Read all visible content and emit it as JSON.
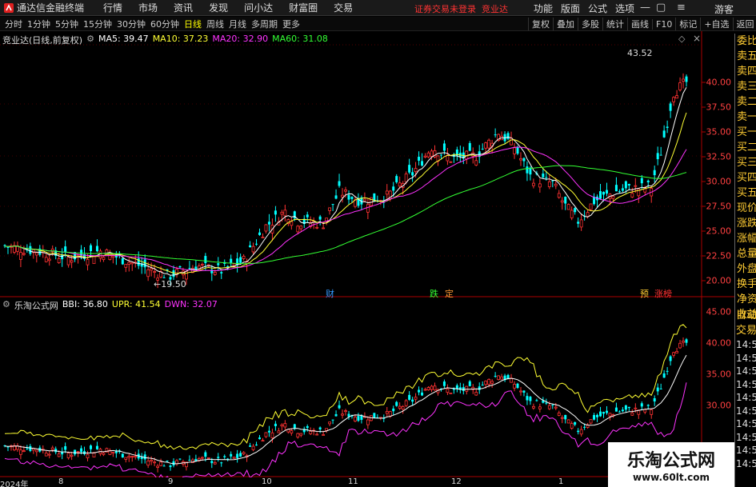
{
  "app": {
    "name": "通达信金融终端",
    "menu": [
      "行情",
      "市场",
      "资讯",
      "发现",
      "问小达",
      "财富圈",
      "交易"
    ],
    "notice": "证券交易未登录",
    "stock_short": "竞业达",
    "right_menu": [
      "功能",
      "版面",
      "公式",
      "选项"
    ],
    "guest": "游客"
  },
  "toolbar": {
    "periods": [
      "分时",
      "1分钟",
      "5分钟",
      "15分钟",
      "30分钟",
      "60分钟",
      "日线",
      "周线",
      "月线",
      "多周期",
      "更多"
    ],
    "active": "日线",
    "tools": [
      "复权",
      "叠加",
      "多股",
      "统计",
      "画线",
      "F10",
      "标记",
      "+自选",
      "返回"
    ]
  },
  "main_pane": {
    "title": "竞业达(日线,前复权)",
    "ma": [
      {
        "label": "MA5: 39.47",
        "color": "#ffffff"
      },
      {
        "label": "MA10: 37.23",
        "color": "#ffff33"
      },
      {
        "label": "MA20: 32.90",
        "color": "#ff33ff"
      },
      {
        "label": "MA60: 31.08",
        "color": "#33ff33"
      }
    ],
    "yticks": [
      "40.00",
      "37.50",
      "35.00",
      "32.50",
      "30.00",
      "27.50",
      "25.00",
      "22.50",
      "20.00"
    ],
    "annot_high": "43.52",
    "annot_low": "19.50",
    "events": [
      {
        "label": "财",
        "color": "#3399ff"
      },
      {
        "label": "跌",
        "color": "#33ff33"
      },
      {
        "label": "定",
        "color": "#ff9933"
      },
      {
        "label": "预",
        "color": "#ffcc33"
      },
      {
        "label": "涨榜",
        "color": "#ff3333"
      }
    ]
  },
  "sub_pane": {
    "title": "乐淘公式网",
    "lines": [
      {
        "label": "BBI: 36.80",
        "color": "#ffffff"
      },
      {
        "label": "UPR: 41.54",
        "color": "#ffff33"
      },
      {
        "label": "DWN: 32.07",
        "color": "#ff33ff"
      }
    ],
    "yticks": [
      "45.00",
      "40.00",
      "35.00",
      "30.00"
    ]
  },
  "sidebar": [
    "委比",
    "卖五",
    "卖四",
    "卖三",
    "卖二",
    "卖一",
    "买一",
    "买二",
    "买三",
    "买四",
    "买五",
    "现价",
    "涨跌",
    "涨幅",
    "总量",
    "外盘",
    "换手",
    "净资",
    "收益"
  ],
  "sidebar2": {
    "labels": [
      "自动",
      "交易"
    ],
    "times": [
      "14:56",
      "14:56",
      "14:56",
      "14:56",
      "14:56",
      "14:56",
      "14:56",
      "14:56",
      "14:56",
      "14:56"
    ]
  },
  "xaxis": [
    "2024年",
    "8",
    "9",
    "10",
    "11",
    "12",
    "1"
  ],
  "colors": {
    "up": "#ff3232",
    "down": "#00ffff",
    "ma5": "#ffffff",
    "ma10": "#ffff33",
    "ma20": "#ff33ff",
    "ma60": "#33ff33"
  },
  "watermark": {
    "line1": "乐淘公式网",
    "line2": "www.60lt.com"
  }
}
